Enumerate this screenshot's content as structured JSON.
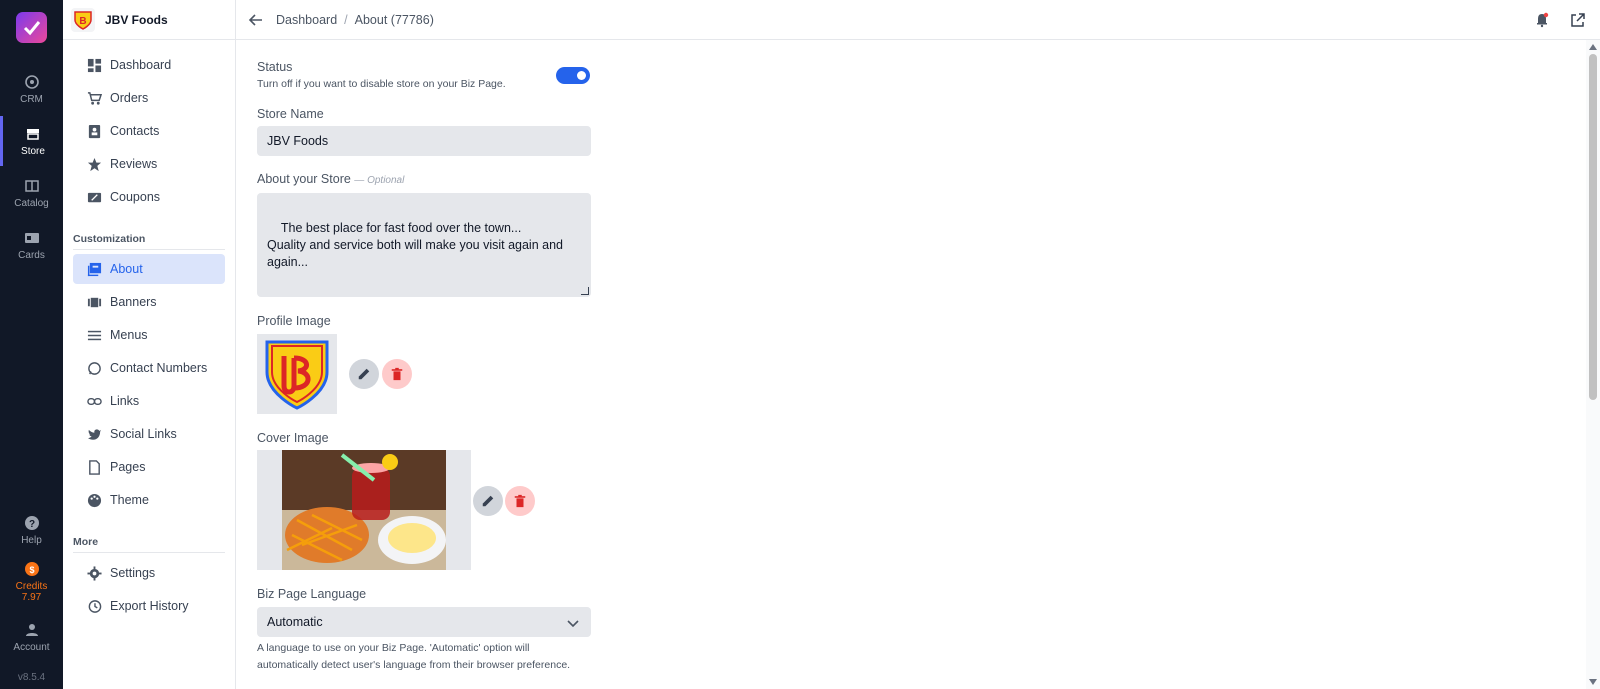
{
  "rail": {
    "items": [
      {
        "label": "CRM",
        "icon": "crm-icon"
      },
      {
        "label": "Store",
        "icon": "store-icon"
      },
      {
        "label": "Catalog",
        "icon": "catalog-icon"
      },
      {
        "label": "Cards",
        "icon": "cards-icon"
      }
    ],
    "help": "Help",
    "credits_label": "Credits",
    "credits_value": "7.97",
    "account": "Account",
    "version": "v8.5.4"
  },
  "sidebar": {
    "brand": "JBV Foods",
    "items": [
      {
        "label": "Dashboard",
        "icon": "dashboard-icon"
      },
      {
        "label": "Orders",
        "icon": "cart-icon"
      },
      {
        "label": "Contacts",
        "icon": "contacts-icon"
      },
      {
        "label": "Reviews",
        "icon": "star-icon"
      },
      {
        "label": "Coupons",
        "icon": "coupon-icon"
      }
    ],
    "customization_label": "Customization",
    "customization": [
      {
        "label": "About",
        "icon": "about-icon"
      },
      {
        "label": "Banners",
        "icon": "banners-icon"
      },
      {
        "label": "Menus",
        "icon": "menu-lines-icon"
      },
      {
        "label": "Contact Numbers",
        "icon": "whatsapp-icon"
      },
      {
        "label": "Links",
        "icon": "link-icon"
      },
      {
        "label": "Social Links",
        "icon": "twitter-icon"
      },
      {
        "label": "Pages",
        "icon": "page-icon"
      },
      {
        "label": "Theme",
        "icon": "palette-icon"
      }
    ],
    "more_label": "More",
    "more": [
      {
        "label": "Settings",
        "icon": "gear-icon"
      },
      {
        "label": "Export History",
        "icon": "history-icon"
      }
    ]
  },
  "header": {
    "crumb_root": "Dashboard",
    "crumb_separator": "/",
    "crumb_current": "About (77786)"
  },
  "form": {
    "status_label": "Status",
    "status_hint": "Turn off if you want to disable store on your Biz Page.",
    "status_on": true,
    "store_name_label": "Store Name",
    "store_name_value": "JBV Foods",
    "about_label": "About your Store",
    "about_optional": "— Optional",
    "about_value": "The best place for fast food over the town...\nQuality and service both will make you visit again and again...",
    "profile_image_label": "Profile Image",
    "cover_image_label": "Cover Image",
    "language_label": "Biz Page Language",
    "language_value": "Automatic",
    "language_hint_1": "A language to use on your Biz Page. 'Automatic' option will",
    "language_hint_2": "automatically detect user's language from their browser preference."
  },
  "colors": {
    "rail_bg": "#111827",
    "accent": "#2563eb",
    "active_bg": "#dbe4fb",
    "credits": "#f97316",
    "delete": "#dc2626"
  }
}
